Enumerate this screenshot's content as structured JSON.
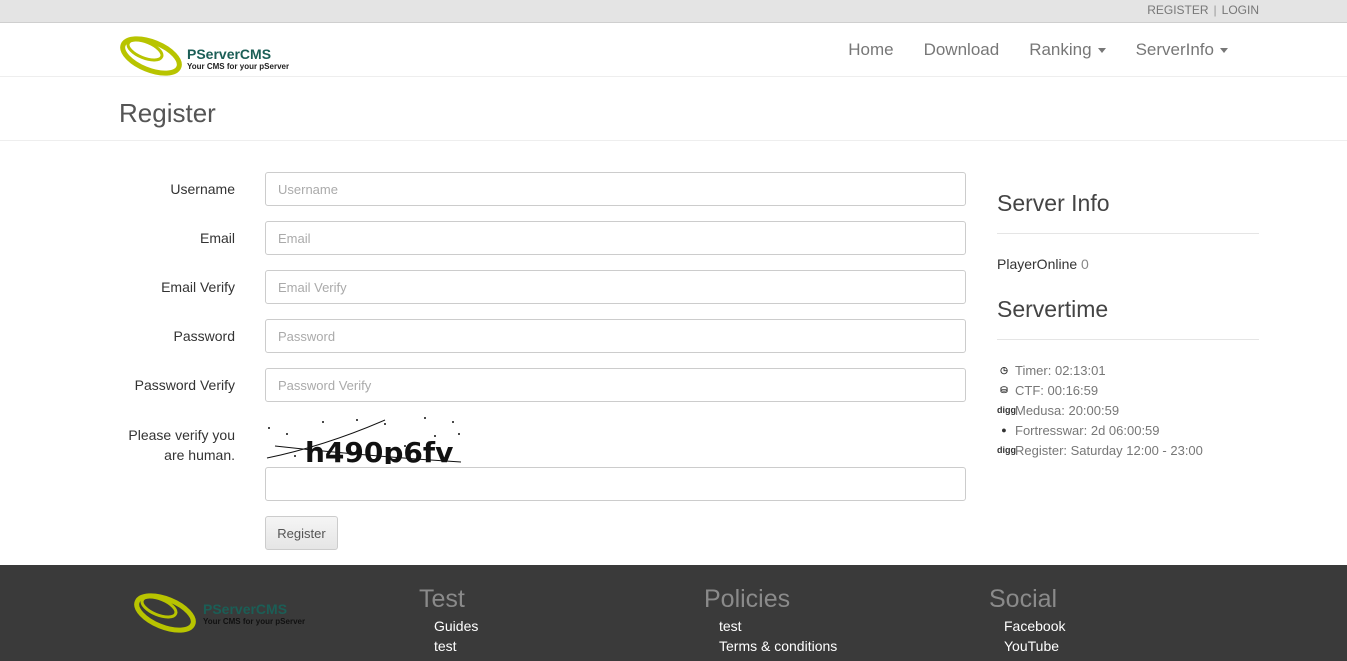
{
  "topbar": {
    "register": "REGISTER",
    "sep": "|",
    "login": "LOGIN"
  },
  "brand": {
    "name": "PServerCMS",
    "tagline": "Your CMS for your pServer",
    "accent": "#b8c400"
  },
  "nav": {
    "home": "Home",
    "download": "Download",
    "ranking": "Ranking",
    "serverinfo": "ServerInfo"
  },
  "page": {
    "title": "Register"
  },
  "form": {
    "username": {
      "label": "Username",
      "placeholder": "Username"
    },
    "email": {
      "label": "Email",
      "placeholder": "Email"
    },
    "email_verify": {
      "label": "Email Verify",
      "placeholder": "Email Verify"
    },
    "password": {
      "label": "Password",
      "placeholder": "Password"
    },
    "password_verify": {
      "label": "Password Verify",
      "placeholder": "Password Verify"
    },
    "captcha_label_1": "Please verify you",
    "captcha_label_2": "are human.",
    "captcha_text": "h490p6fv",
    "submit": "Register"
  },
  "sidebar": {
    "server_info_title": "Server Info",
    "player_online_label": "PlayerOnline",
    "player_online_value": "0",
    "servertime_title": "Servertime",
    "times": [
      {
        "icon": "clock-icon",
        "text": "Timer: 02:13:01"
      },
      {
        "icon": "coins-icon",
        "text": "CTF: 00:16:59"
      },
      {
        "icon": "digg-icon",
        "text": "Medusa: 20:00:59"
      },
      {
        "icon": "bomb-icon",
        "text": "Fortresswar: 2d 06:00:59"
      },
      {
        "icon": "digg-icon",
        "text": "Register: Saturday 12:00 - 23:00"
      }
    ]
  },
  "footer": {
    "test": {
      "title": "Test",
      "links": [
        "Guides",
        "test"
      ]
    },
    "policies": {
      "title": "Policies",
      "links": [
        "test",
        "Terms & conditions"
      ]
    },
    "social": {
      "title": "Social",
      "links": [
        "Facebook",
        "YouTube"
      ]
    }
  }
}
